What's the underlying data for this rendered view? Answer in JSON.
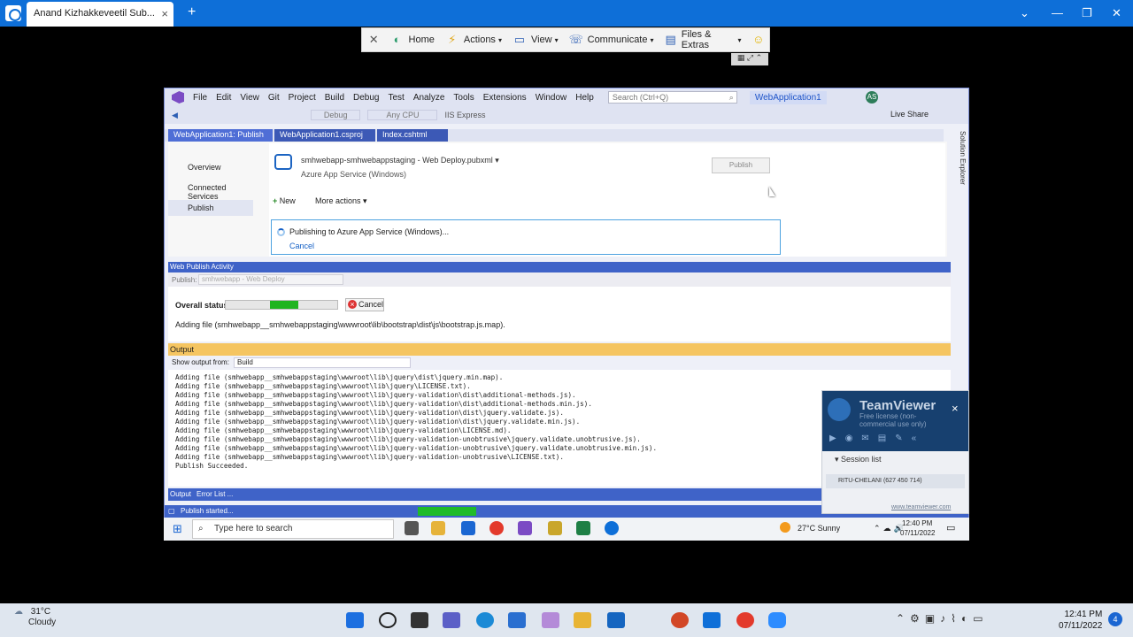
{
  "outer_window": {
    "tab_title": "Anand Kizhakkeveetil Sub...",
    "tab_close": "×",
    "new_tab": "+",
    "controls": [
      "⌄",
      "—",
      "❐",
      "✕"
    ]
  },
  "remote_toolbar": {
    "items": [
      {
        "label": "Home",
        "icon": "home-icon"
      },
      {
        "label": "Actions",
        "icon": "lightning-icon"
      },
      {
        "label": "View",
        "icon": "monitor-icon"
      },
      {
        "label": "Communicate",
        "icon": "phone-icon"
      },
      {
        "label": "Files & Extras",
        "icon": "folder-icon"
      }
    ],
    "close": "✕",
    "emoji": "☺"
  },
  "vs": {
    "menu": [
      "File",
      "Edit",
      "View",
      "Git",
      "Project",
      "Build",
      "Debug",
      "Test",
      "Analyze",
      "Tools",
      "Extensions",
      "Window",
      "Help"
    ],
    "search_placeholder": "Search (Ctrl+Q)",
    "solution": "WebApplication1",
    "avatar": "AS",
    "toolbar": {
      "config": "Debug",
      "platform": "Any CPU",
      "run": "IIS Express"
    },
    "live_share": "Live Share",
    "doc_tabs": [
      "WebApplication1: Publish",
      "WebApplication1.csproj",
      "Index.cshtml"
    ],
    "solution_explorer": "Solution Explorer",
    "publish": {
      "nav": [
        "Overview",
        "Connected Services",
        "Publish"
      ],
      "profile": "smhwebapp-smhwebappstaging - Web Deploy.pubxml",
      "profile_sub": "Azure App Service (Windows)",
      "publish_button": "Publish",
      "new": "New",
      "more_actions": "More actions",
      "publishing_msg": "Publishing to Azure App Service (Windows)...",
      "cancel": "Cancel"
    },
    "web_publish": {
      "title": "Web Publish Activity",
      "publish_label": "Publish:",
      "publish_value": "smhwebapp - Web Deploy",
      "overall_status": "Overall status",
      "progress": 0.25,
      "cancel": "Cancel",
      "adding": "Adding file (smhwebapp__smhwebappstaging\\wwwroot\\lib\\bootstrap\\dist\\js\\bootstrap.js.map)."
    },
    "output": {
      "title": "Output",
      "show_from": "Show output from:",
      "source": "Build",
      "lines": [
        "Adding file (smhwebapp__smhwebappstaging\\wwwroot\\lib\\jquery\\dist\\jquery.min.map).",
        "Adding file (smhwebapp__smhwebappstaging\\wwwroot\\lib\\jquery\\LICENSE.txt).",
        "Adding file (smhwebapp__smhwebappstaging\\wwwroot\\lib\\jquery-validation\\dist\\additional-methods.js).",
        "Adding file (smhwebapp__smhwebappstaging\\wwwroot\\lib\\jquery-validation\\dist\\additional-methods.min.js).",
        "Adding file (smhwebapp__smhwebappstaging\\wwwroot\\lib\\jquery-validation\\dist\\jquery.validate.js).",
        "Adding file (smhwebapp__smhwebappstaging\\wwwroot\\lib\\jquery-validation\\dist\\jquery.validate.min.js).",
        "Adding file (smhwebapp__smhwebappstaging\\wwwroot\\lib\\jquery-validation\\LICENSE.md).",
        "Adding file (smhwebapp__smhwebappstaging\\wwwroot\\lib\\jquery-validation-unobtrusive\\jquery.validate.unobtrusive.js).",
        "Adding file (smhwebapp__smhwebappstaging\\wwwroot\\lib\\jquery-validation-unobtrusive\\jquery.validate.unobtrusive.min.js).",
        "Adding file (smhwebapp__smhwebappstaging\\wwwroot\\lib\\jquery-validation-unobtrusive\\LICENSE.txt).",
        "Publish Succeeded."
      ],
      "tabs": [
        "Output",
        "Error List ..."
      ]
    },
    "status": "Publish started..."
  },
  "remote_taskbar": {
    "search": "Type here to search",
    "weather": "27°C  Sunny",
    "time": "12:40 PM",
    "date": "07/11/2022"
  },
  "teamviewer": {
    "name": "TeamViewer",
    "license": "Free license (non-commercial use only)",
    "session_list": "Session list",
    "session": "RITU-CHELANI (627 450 714)",
    "url": "www.teamviewer.com"
  },
  "local_taskbar": {
    "temp": "31°C",
    "condition": "Cloudy",
    "time": "12:41 PM",
    "date": "07/11/2022",
    "notifications": "4"
  },
  "colors": {
    "tv_blue": "#0e6fd8",
    "vs_accent": "#3f63c8",
    "progress_green": "#1fb41f",
    "output_header": "#f5c561"
  }
}
